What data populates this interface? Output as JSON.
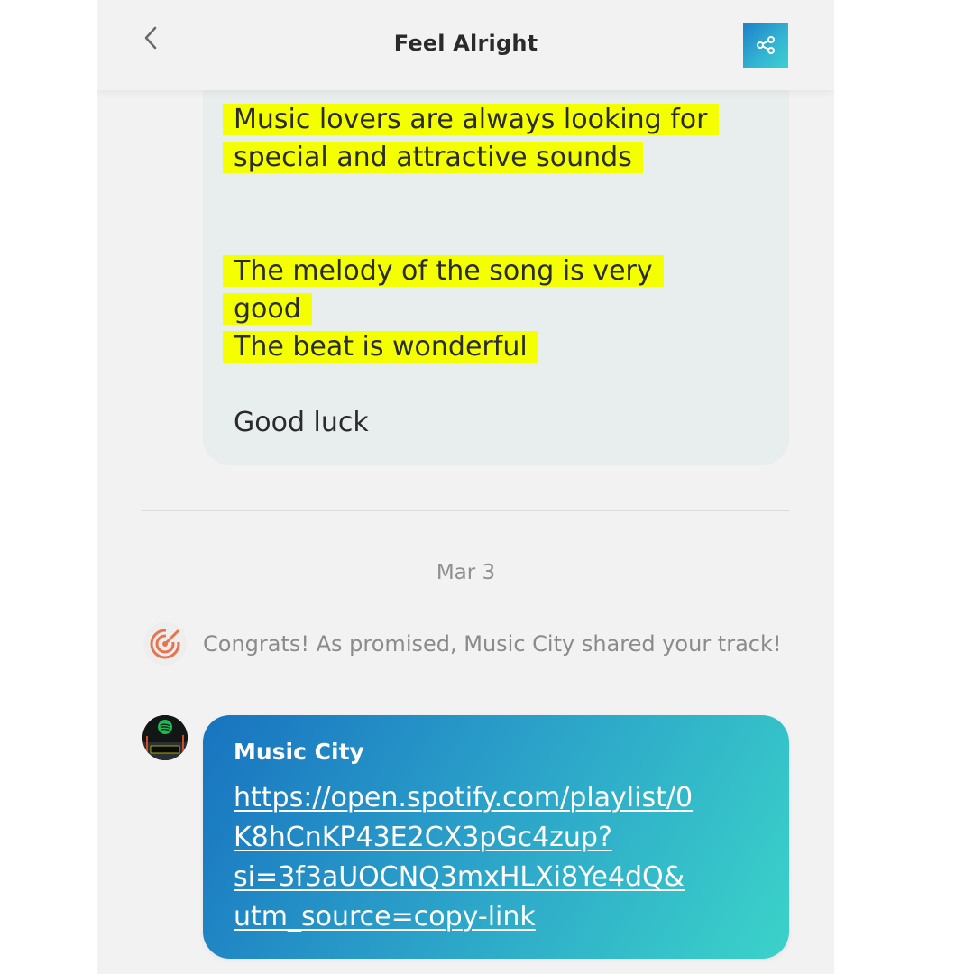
{
  "header": {
    "title": "Feel Alright",
    "back_icon": "chevron-left-icon",
    "share_icon": "share-icon"
  },
  "message": {
    "lines": [
      "Music lovers are always looking for",
      "special and attractive sounds",
      "The melody of the song is very",
      "good",
      "The beat is wonderful",
      "Good luck"
    ],
    "highlight_color": "#f4ff00"
  },
  "date": "Mar 3",
  "notification": {
    "icon": "target-icon",
    "text": "Congrats! As promised, Music City shared your track!"
  },
  "chat": {
    "avatar_text": "Spotify Music City",
    "sender": "Music City",
    "link_lines": [
      "https://open.spotify.com/playlist/0",
      "K8hCnKP43E2CX3pGc4zup?",
      "si=3f3aUOCNQ3mxHLXi8Ye4dQ&",
      "utm_source=copy-link"
    ]
  },
  "colors": {
    "background": "#f2f2f3",
    "card": "#e8eeee",
    "accent_gradient_start": "#1873c0",
    "accent_gradient_end": "#3bd3c9",
    "notification_icon": "#e8734f"
  }
}
